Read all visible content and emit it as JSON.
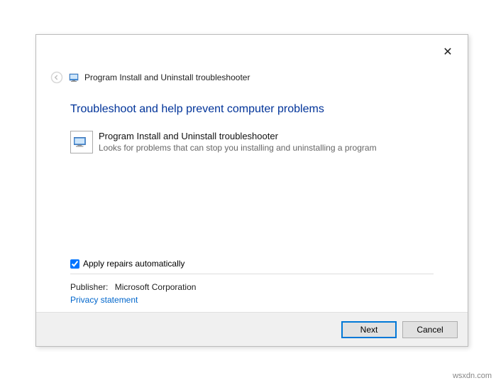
{
  "close_label": "✕",
  "header": {
    "title": "Program Install and Uninstall troubleshooter"
  },
  "main_heading": "Troubleshoot and help prevent computer problems",
  "troubleshooter": {
    "title": "Program Install and Uninstall troubleshooter",
    "description": "Looks for problems that can stop you installing and uninstalling a program"
  },
  "apply_checkbox_label": "Apply repairs automatically",
  "apply_checked": true,
  "publisher_label": "Publisher:",
  "publisher_value": "Microsoft Corporation",
  "privacy_link": "Privacy statement",
  "buttons": {
    "next": "Next",
    "cancel": "Cancel"
  },
  "watermark": "wsxdn.com"
}
